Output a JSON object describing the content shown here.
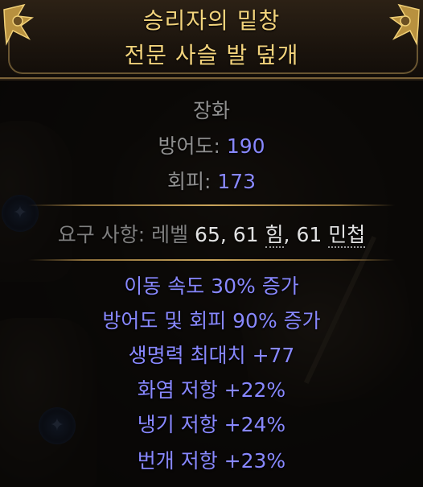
{
  "item": {
    "name_line1": "승리자의 밑창",
    "name_line2": "전문 사슬 발 덮개",
    "item_class": "장화",
    "defenses": [
      {
        "label": "방어도:",
        "value": "190"
      },
      {
        "label": "회피:",
        "value": "173"
      }
    ],
    "requirements": {
      "label": "요구 사항:",
      "level_text": "레벨",
      "level": "65,",
      "str_value": "61",
      "str_label": "힘",
      "comma": ",",
      "dex_value": "61",
      "dex_label": "민첩"
    },
    "modifiers": [
      "이동 속도 30% 증가",
      "방어도 및 회피 90% 증가",
      "생명력 최대치 +77",
      "화염 저항 +22%",
      "냉기 저항 +24%",
      "번개 저항 +23%"
    ]
  },
  "colors": {
    "title": "#f2d37c",
    "property_label": "#8f8f8f",
    "augmented_value": "#8888ff",
    "requirement_value": "#e2e2e2",
    "explicit_mod": "#8888ff",
    "separator": "#c9a45a"
  },
  "icons": {
    "background_orbs": "socket-orb-icon",
    "header_ornament": "gilded-ornament-icon"
  }
}
